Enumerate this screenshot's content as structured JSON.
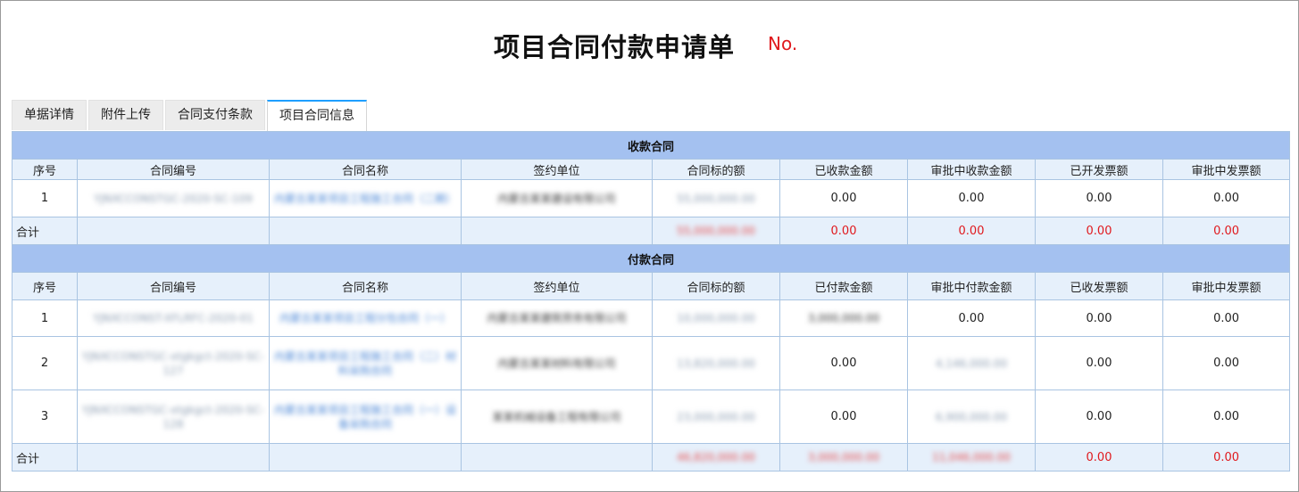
{
  "title": "项目合同付款申请单",
  "no_label": "No.",
  "tabs": [
    "单据详情",
    "附件上传",
    "合同支付条款",
    "项目合同信息"
  ],
  "receipt": {
    "section_title": "收款合同",
    "headers": [
      "序号",
      "合同编号",
      "合同名称",
      "签约单位",
      "合同标的额",
      "已收款金额",
      "审批中收款金额",
      "已开发票额",
      "审批中发票额"
    ],
    "rows": [
      {
        "seq": "1",
        "code": "YJNXCCONSTGC-2020-SC-109",
        "name": "内蒙古某某项目工程施工合同（二期）",
        "party": "内蒙古某某建设有限公司",
        "amount": "55,000,000.00",
        "received": "0.00",
        "received_pending": "0.00",
        "invoiced": "0.00",
        "invoice_pending": "0.00"
      }
    ],
    "total": {
      "label": "合计",
      "amount": "55,000,000.00",
      "received": "0.00",
      "received_pending": "0.00",
      "invoiced": "0.00",
      "invoice_pending": "0.00"
    }
  },
  "payment": {
    "section_title": "付款合同",
    "headers": [
      "序号",
      "合同编号",
      "合同名称",
      "签约单位",
      "合同标的额",
      "已付款金额",
      "审批中付款金额",
      "已收发票额",
      "审批中发票额"
    ],
    "rows": [
      {
        "seq": "1",
        "code": "YJNXCCONST-XFLRFC-2020-01",
        "name": "内蒙古某某项目工程分包合同（一）",
        "party": "内蒙古某某建筑劳务有限公司",
        "amount": "10,000,000.00",
        "paid": "3,000,000.00",
        "paid_pending": "0.00",
        "invoiced": "0.00",
        "invoice_pending": "0.00"
      },
      {
        "seq": "2",
        "code": "YJNXCCONSTGC-xtgkgct-2020-SC-127",
        "name": "内蒙古某某项目工程施工合同（二）材料采购合同",
        "party": "内蒙古某某材料有限公司",
        "amount": "13,820,000.00",
        "paid": "0.00",
        "paid_pending": "4,146,000.00",
        "invoiced": "0.00",
        "invoice_pending": "0.00"
      },
      {
        "seq": "3",
        "code": "YJNXCCONSTGC-xtgkgct-2020-SC-128",
        "name": "内蒙古某某项目工程施工合同（一）设备采购合同",
        "party": "某某机械设备工程有限公司",
        "amount": "23,000,000.00",
        "paid": "0.00",
        "paid_pending": "6,900,000.00",
        "invoiced": "0.00",
        "invoice_pending": "0.00"
      }
    ],
    "total": {
      "label": "合计",
      "amount": "46,820,000.00",
      "paid": "3,000,000.00",
      "paid_pending": "11,046,000.00",
      "invoiced": "0.00",
      "invoice_pending": "0.00"
    }
  },
  "colors": {
    "header_band": "#a4c1f0",
    "sub_header": "#e6f0fb",
    "total_red": "#e0191d",
    "active_tab_accent": "#1e9fff"
  }
}
